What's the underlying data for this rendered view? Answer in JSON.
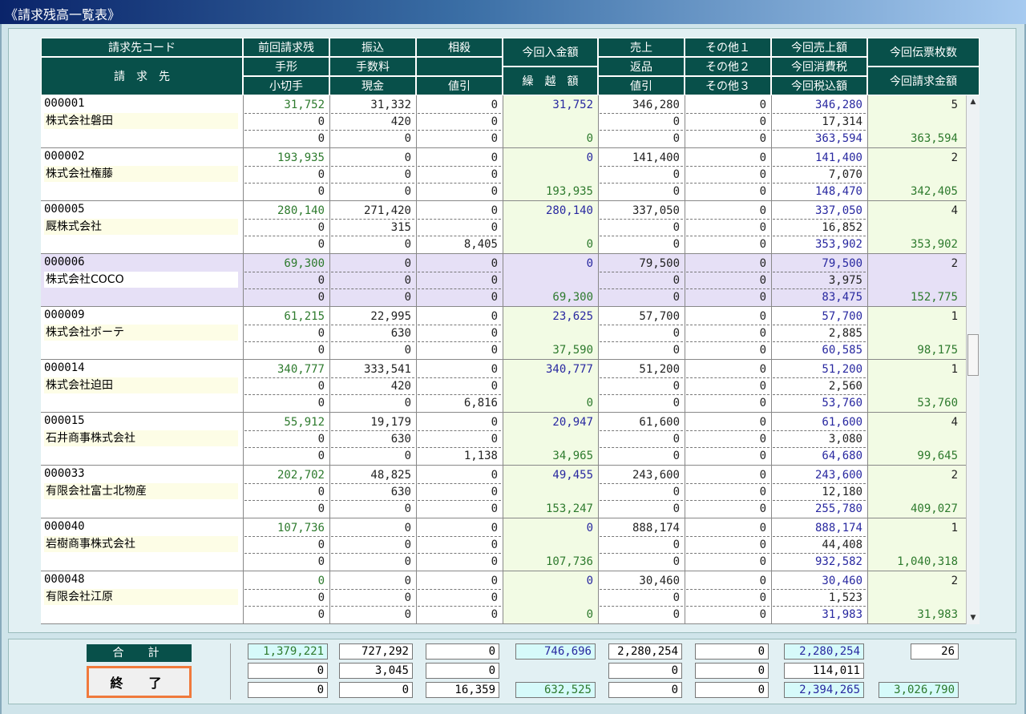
{
  "window": {
    "title": "《請求残高一覧表》"
  },
  "header": {
    "code": "請求先コード",
    "customer": "請　求　先",
    "prev": "前回請求残",
    "tegata": "手形",
    "kogitte": "小切手",
    "furikomi": "振込",
    "tesuryo": "手数料",
    "genkin": "現金",
    "sousai": "相殺",
    "blank": "",
    "nebiki1": "値引",
    "nyukin": "今回入金額",
    "kurikoshi": "繰　越　額",
    "uriage": "売上",
    "henpin": "返品",
    "nebiki2": "値引",
    "other1": "その他１",
    "other2": "その他２",
    "other3": "その他３",
    "cur_sales": "今回売上額",
    "cur_tax": "今回消費税",
    "cur_taxin": "今回税込額",
    "slips": "今回伝票枚数",
    "billing": "今回請求金額"
  },
  "rows": [
    {
      "code": "000001",
      "name": "株式会社磐田",
      "c1": [
        "31,752",
        "0",
        "0"
      ],
      "c2": [
        "31,332",
        "420",
        "0"
      ],
      "c3": [
        "0",
        "0",
        "0"
      ],
      "c4a": "31,752",
      "c4b": "0",
      "c5": [
        "346,280",
        "0",
        "0"
      ],
      "c6": [
        "0",
        "0",
        "0"
      ],
      "c7": [
        "346,280",
        "17,314",
        "363,594"
      ],
      "c8a": "5",
      "c8b": "363,594"
    },
    {
      "code": "000002",
      "name": "株式会社権藤",
      "c1": [
        "193,935",
        "0",
        "0"
      ],
      "c2": [
        "0",
        "0",
        "0"
      ],
      "c3": [
        "0",
        "0",
        "0"
      ],
      "c4a": "0",
      "c4b": "193,935",
      "c5": [
        "141,400",
        "0",
        "0"
      ],
      "c6": [
        "0",
        "0",
        "0"
      ],
      "c7": [
        "141,400",
        "7,070",
        "148,470"
      ],
      "c8a": "2",
      "c8b": "342,405"
    },
    {
      "code": "000005",
      "name": "厩株式会社",
      "c1": [
        "280,140",
        "0",
        "0"
      ],
      "c2": [
        "271,420",
        "315",
        "0"
      ],
      "c3": [
        "0",
        "0",
        "8,405"
      ],
      "c4a": "280,140",
      "c4b": "0",
      "c5": [
        "337,050",
        "0",
        "0"
      ],
      "c6": [
        "0",
        "0",
        "0"
      ],
      "c7": [
        "337,050",
        "16,852",
        "353,902"
      ],
      "c8a": "4",
      "c8b": "353,902"
    },
    {
      "code": "000006",
      "name": "株式会社COCO",
      "c1": [
        "69,300",
        "0",
        "0"
      ],
      "c2": [
        "0",
        "0",
        "0"
      ],
      "c3": [
        "0",
        "0",
        "0"
      ],
      "c4a": "0",
      "c4b": "69,300",
      "c5": [
        "79,500",
        "0",
        "0"
      ],
      "c6": [
        "0",
        "0",
        "0"
      ],
      "c7": [
        "79,500",
        "3,975",
        "83,475"
      ],
      "c8a": "2",
      "c8b": "152,775",
      "selected": true
    },
    {
      "code": "000009",
      "name": "株式会社ボーテ",
      "c1": [
        "61,215",
        "0",
        "0"
      ],
      "c2": [
        "22,995",
        "630",
        "0"
      ],
      "c3": [
        "0",
        "0",
        "0"
      ],
      "c4a": "23,625",
      "c4b": "37,590",
      "c5": [
        "57,700",
        "0",
        "0"
      ],
      "c6": [
        "0",
        "0",
        "0"
      ],
      "c7": [
        "57,700",
        "2,885",
        "60,585"
      ],
      "c8a": "1",
      "c8b": "98,175"
    },
    {
      "code": "000014",
      "name": "株式会社迫田",
      "c1": [
        "340,777",
        "0",
        "0"
      ],
      "c2": [
        "333,541",
        "420",
        "0"
      ],
      "c3": [
        "0",
        "0",
        "6,816"
      ],
      "c4a": "340,777",
      "c4b": "0",
      "c5": [
        "51,200",
        "0",
        "0"
      ],
      "c6": [
        "0",
        "0",
        "0"
      ],
      "c7": [
        "51,200",
        "2,560",
        "53,760"
      ],
      "c8a": "1",
      "c8b": "53,760"
    },
    {
      "code": "000015",
      "name": "石井商事株式会社",
      "c1": [
        "55,912",
        "0",
        "0"
      ],
      "c2": [
        "19,179",
        "630",
        "0"
      ],
      "c3": [
        "0",
        "0",
        "1,138"
      ],
      "c4a": "20,947",
      "c4b": "34,965",
      "c5": [
        "61,600",
        "0",
        "0"
      ],
      "c6": [
        "0",
        "0",
        "0"
      ],
      "c7": [
        "61,600",
        "3,080",
        "64,680"
      ],
      "c8a": "4",
      "c8b": "99,645"
    },
    {
      "code": "000033",
      "name": "有限会社富士北物産",
      "c1": [
        "202,702",
        "0",
        "0"
      ],
      "c2": [
        "48,825",
        "630",
        "0"
      ],
      "c3": [
        "0",
        "0",
        "0"
      ],
      "c4a": "49,455",
      "c4b": "153,247",
      "c5": [
        "243,600",
        "0",
        "0"
      ],
      "c6": [
        "0",
        "0",
        "0"
      ],
      "c7": [
        "243,600",
        "12,180",
        "255,780"
      ],
      "c8a": "2",
      "c8b": "409,027"
    },
    {
      "code": "000040",
      "name": "岩樹商事株式会社",
      "c1": [
        "107,736",
        "0",
        "0"
      ],
      "c2": [
        "0",
        "0",
        "0"
      ],
      "c3": [
        "0",
        "0",
        "0"
      ],
      "c4a": "0",
      "c4b": "107,736",
      "c5": [
        "888,174",
        "0",
        "0"
      ],
      "c6": [
        "0",
        "0",
        "0"
      ],
      "c7": [
        "888,174",
        "44,408",
        "932,582"
      ],
      "c8a": "1",
      "c8b": "1,040,318"
    },
    {
      "code": "000048",
      "name": "有限会社江原",
      "c1": [
        "0",
        "0",
        "0"
      ],
      "c2": [
        "0",
        "0",
        "0"
      ],
      "c3": [
        "0",
        "0",
        "0"
      ],
      "c4a": "0",
      "c4b": "0",
      "c5": [
        "30,460",
        "0",
        "0"
      ],
      "c6": [
        "0",
        "0",
        "0"
      ],
      "c7": [
        "30,460",
        "1,523",
        "31,983"
      ],
      "c8a": "2",
      "c8b": "31,983"
    }
  ],
  "totals": {
    "label": "合　計",
    "end_button": "終　了",
    "r1": [
      "1,379,221",
      "727,292",
      "0",
      "746,696",
      "2,280,254",
      "0",
      "2,280,254",
      "26"
    ],
    "r2": [
      "0",
      "3,045",
      "0",
      "",
      "0",
      "0",
      "114,011",
      ""
    ],
    "r3": [
      "0",
      "0",
      "16,359",
      "632,525",
      "0",
      "0",
      "2,394,265",
      "3,026,790"
    ]
  },
  "colors": {
    "header_bg": "#08504a",
    "positive_green": "#2d7a2d",
    "blue_value": "#2828a0",
    "selected_row": "#e6e0f6",
    "end_button_border": "#f07a3c"
  },
  "scrollbar": {
    "up_icon": "▲",
    "down_icon": "▼"
  }
}
